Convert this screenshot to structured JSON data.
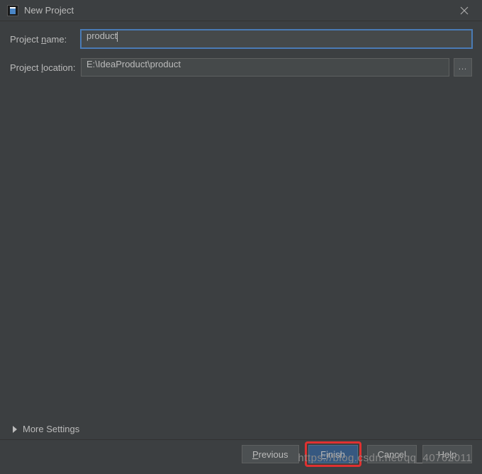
{
  "window": {
    "title": "New Project"
  },
  "form": {
    "projectName": {
      "label_prefix": "Project ",
      "label_mnemonic": "n",
      "label_suffix": "ame:",
      "value": "product"
    },
    "projectLocation": {
      "label_prefix": "Project ",
      "label_mnemonic": "l",
      "label_suffix": "ocation:",
      "value": "E:\\IdeaProduct\\product"
    },
    "browseEllipsis": "..."
  },
  "moreSettings": {
    "label": "More Settings"
  },
  "buttons": {
    "previous": {
      "mnemonic": "P",
      "rest": "revious"
    },
    "finish": {
      "mnemonic": "F",
      "rest": "inish"
    },
    "cancel": "Cancel",
    "help": "Help"
  },
  "watermark": "https://blog.csdn.net/qq_40762011"
}
